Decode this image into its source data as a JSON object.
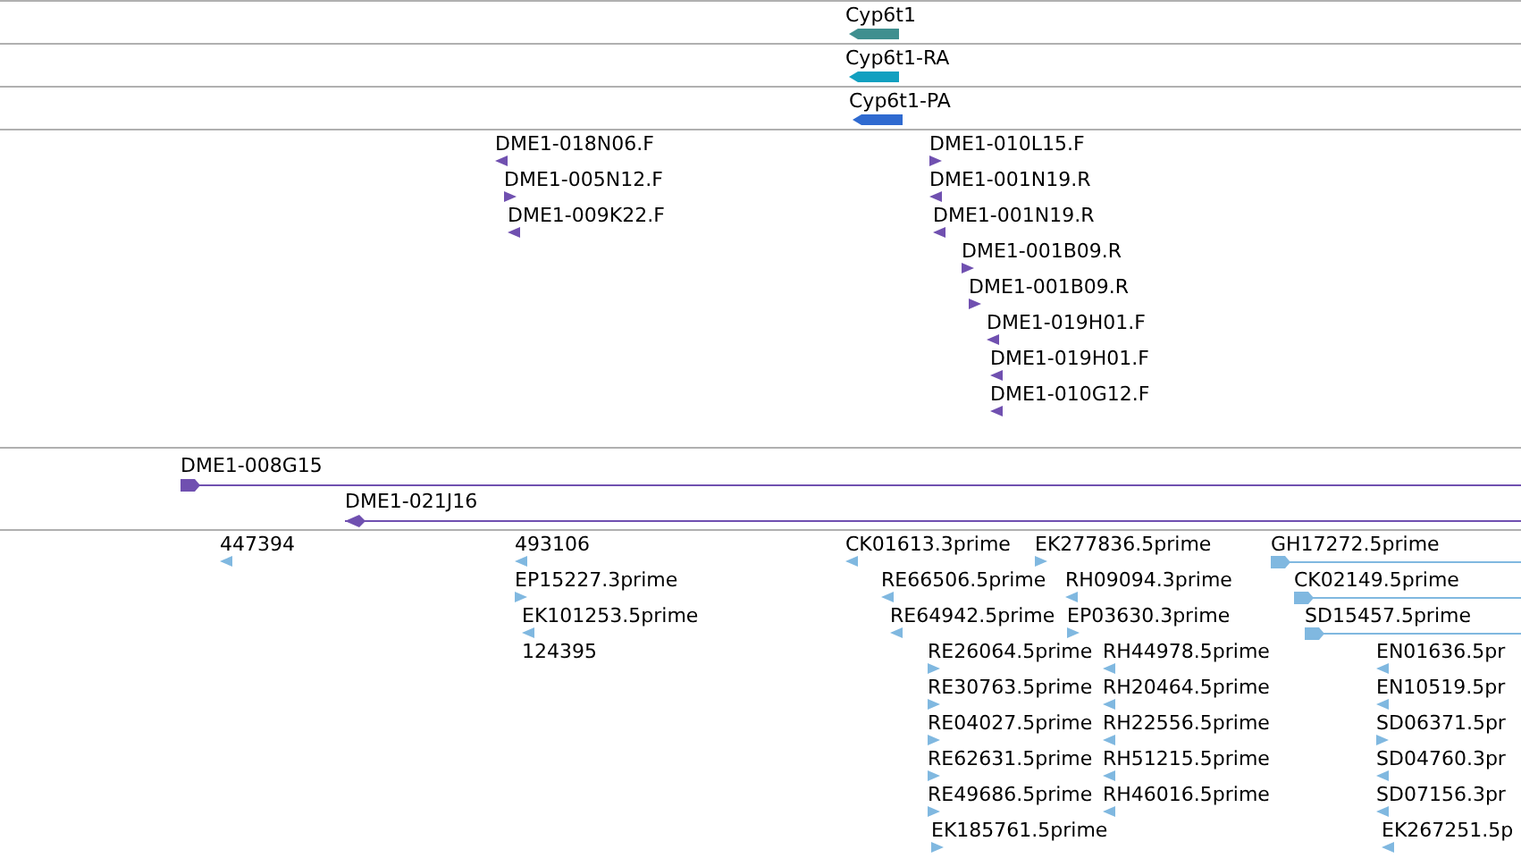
{
  "tracks": [
    {
      "kind": "gene",
      "color": "#3f8f8f",
      "features": [
        {
          "label": "Cyp6t1",
          "reverse": true
        }
      ]
    },
    {
      "kind": "gene",
      "color": "#12a0c0",
      "features": [
        {
          "label": "Cyp6t1-RA",
          "reverse": true
        }
      ]
    },
    {
      "kind": "gene",
      "color": "#2f6ad0",
      "features": [
        {
          "label": "Cyp6t1-PA",
          "reverse": true
        }
      ]
    },
    {
      "kind": "marker",
      "color": "#7050b0",
      "features": [
        {
          "label": "DME1-018N06.F",
          "reverse": true
        },
        {
          "label": "DME1-005N12.F",
          "reverse": false
        },
        {
          "label": "DME1-009K22.F",
          "reverse": true
        },
        {
          "label": "DME1-010L15.F",
          "reverse": false
        },
        {
          "label": "DME1-001N19.R",
          "reverse": true
        },
        {
          "label": "DME1-001N19.R",
          "reverse": true
        },
        {
          "label": "DME1-001B09.R",
          "reverse": false
        },
        {
          "label": "DME1-001B09.R",
          "reverse": false
        },
        {
          "label": "DME1-019H01.F",
          "reverse": true
        },
        {
          "label": "DME1-019H01.F",
          "reverse": true
        },
        {
          "label": "DME1-010G12.F",
          "reverse": true
        }
      ]
    },
    {
      "kind": "span",
      "color": "#7050b0",
      "features": [
        {
          "label": "DME1-008G15",
          "reverse": false
        },
        {
          "label": "DME1-021J16",
          "reverse": true
        }
      ]
    },
    {
      "kind": "marker",
      "color": "#80b8e0",
      "features": [
        {
          "label": "447394",
          "kind": "arrow",
          "reverse": true
        },
        {
          "label": "493106",
          "kind": "arrow",
          "reverse": true
        },
        {
          "label": "EP15227.3prime",
          "kind": "arrow",
          "reverse": false
        },
        {
          "label": "EK101253.5prime",
          "kind": "arrow",
          "reverse": true
        },
        {
          "label": "124395",
          "kind": "label"
        },
        {
          "label": "CK01613.3prime",
          "kind": "arrow",
          "reverse": true
        },
        {
          "label": "RE66506.5prime",
          "kind": "arrow",
          "reverse": true
        },
        {
          "label": "RE64942.5prime",
          "kind": "arrow",
          "reverse": true
        },
        {
          "label": "RE26064.5prime",
          "kind": "arrow",
          "reverse": false
        },
        {
          "label": "RE30763.5prime",
          "kind": "arrow",
          "reverse": false
        },
        {
          "label": "RE04027.5prime",
          "kind": "arrow",
          "reverse": false
        },
        {
          "label": "RE62631.5prime",
          "kind": "arrow",
          "reverse": false
        },
        {
          "label": "RE49686.5prime",
          "kind": "arrow",
          "reverse": false
        },
        {
          "label": "EK185761.5prime",
          "kind": "arrow",
          "reverse": false
        },
        {
          "label": "EK277836.5prime",
          "kind": "arrow",
          "reverse": false
        },
        {
          "label": "RH09094.3prime",
          "kind": "arrow",
          "reverse": true
        },
        {
          "label": "EP03630.3prime",
          "kind": "arrow",
          "reverse": false
        },
        {
          "label": "RH44978.5prime",
          "kind": "arrow",
          "reverse": true
        },
        {
          "label": "RH20464.5prime",
          "kind": "arrow",
          "reverse": true
        },
        {
          "label": "RH22556.5prime",
          "kind": "arrow",
          "reverse": true
        },
        {
          "label": "RH51215.5prime",
          "kind": "arrow",
          "reverse": true
        },
        {
          "label": "RH46016.5prime",
          "kind": "arrow",
          "reverse": true
        },
        {
          "label": "GH17272.5prime",
          "kind": "span",
          "reverse": false
        },
        {
          "label": "CK02149.5prime",
          "kind": "span",
          "reverse": false
        },
        {
          "label": "SD15457.5prime",
          "kind": "span",
          "reverse": false
        },
        {
          "label": "EN01636.5pr",
          "kind": "arrow",
          "reverse": true
        },
        {
          "label": "EN10519.5pr",
          "kind": "arrow",
          "reverse": true
        },
        {
          "label": "SD06371.5pr",
          "kind": "arrow",
          "reverse": false
        },
        {
          "label": "SD04760.3pr",
          "kind": "arrow",
          "reverse": true
        },
        {
          "label": "SD07156.3pr",
          "kind": "arrow",
          "reverse": true
        },
        {
          "label": "EK267251.5p",
          "kind": "arrow",
          "reverse": true
        }
      ]
    }
  ]
}
